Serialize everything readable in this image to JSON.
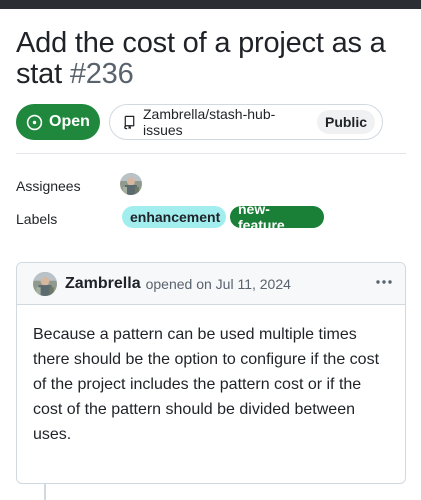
{
  "issue": {
    "title": "Add the cost of a project as a stat",
    "number": "#236",
    "state": "Open",
    "repo": "Zambrella/stash-hub-issues",
    "visibility": "Public"
  },
  "meta": {
    "assignees_label": "Assignees",
    "labels_label": "Labels",
    "labels": [
      {
        "name": "enhancement",
        "color": "#a2eeef"
      },
      {
        "name": "new-feature",
        "color": "#1a7f37"
      }
    ]
  },
  "comment": {
    "author": "Zambrella",
    "opened_text": "opened on Jul 11, 2024",
    "body": "Because a pattern can be used multiple times there should be the option to configure if the cost of the project includes the pattern cost or if the cost of the pattern should be divided between uses."
  },
  "icons": {
    "state": "issue-open-icon",
    "repo": "repo-icon",
    "menu": "kebab-horizontal-icon"
  },
  "colors": {
    "open_green": "#1f883d",
    "border": "#d1d9e0",
    "muted_text": "#59636e"
  }
}
